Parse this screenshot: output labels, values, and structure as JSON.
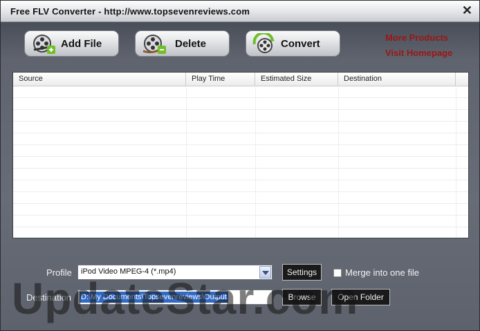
{
  "window": {
    "title": "Free FLV Converter - http://www.topsevenreviews.com",
    "close_glyph": "✕"
  },
  "toolbar": {
    "add_file_label": "Add File",
    "delete_label": "Delete",
    "convert_label": "Convert"
  },
  "links": {
    "more_products": "More Products",
    "visit_homepage": "Visit Homepage"
  },
  "file_list": {
    "columns": [
      "Source",
      "Play Time",
      "Estimated Size",
      "Destination"
    ],
    "rows": []
  },
  "profile": {
    "label": "Profile",
    "selected": "iPod Video MPEG-4 (*.mp4)",
    "settings_label": "Settings",
    "merge_label": "Merge into one file",
    "merge_checked": false
  },
  "destination": {
    "label": "Destination",
    "value": "D:\\My Documents\\Topsevenreviews\\Output",
    "browse_label": "Browse",
    "open_folder_label": "Open Folder"
  },
  "watermark": "UpdateStar.com",
  "colors": {
    "link": "#9b1616",
    "accent_green": "#6fbf2a",
    "selection": "#316ac5"
  }
}
